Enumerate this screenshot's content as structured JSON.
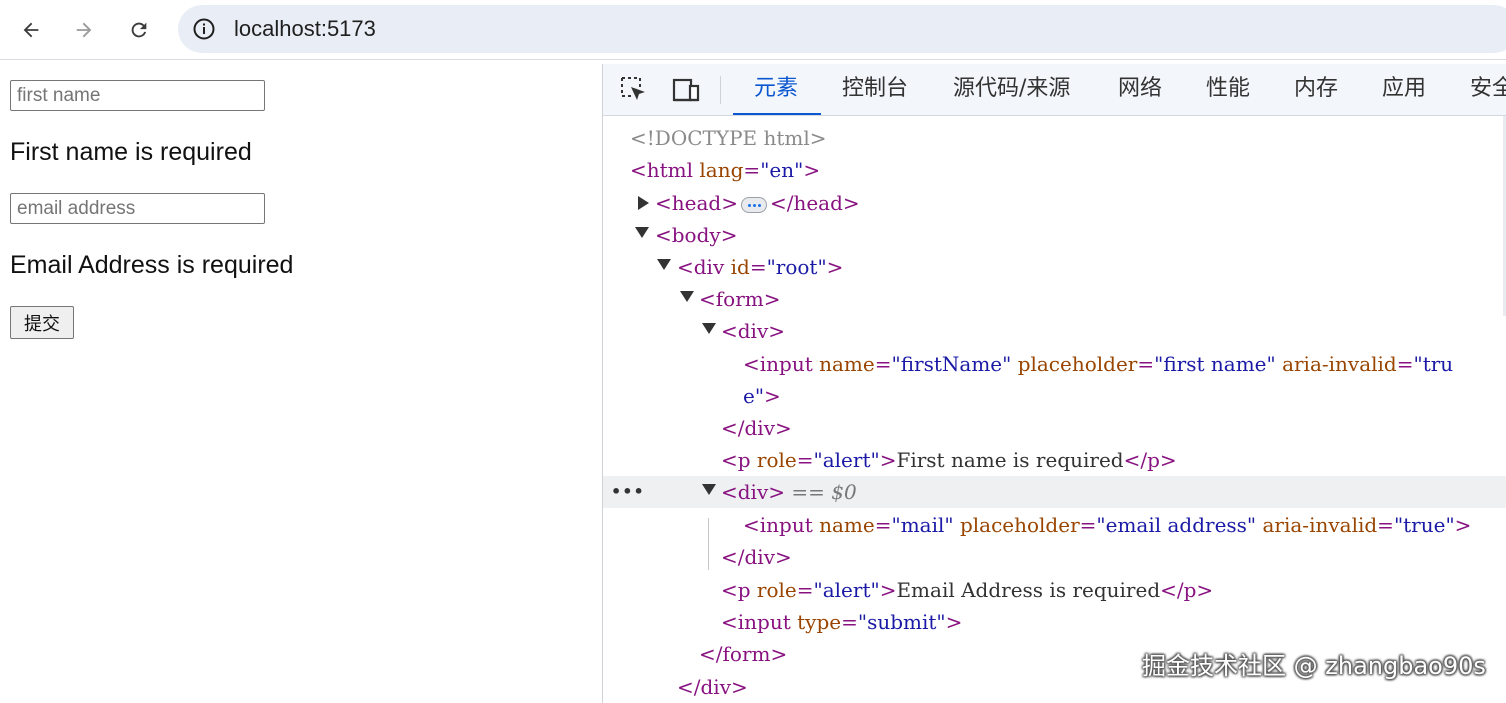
{
  "browser": {
    "url": "localhost:5173"
  },
  "form": {
    "first_name_placeholder": "first name",
    "first_name_value": "",
    "first_name_error": "First name is required",
    "email_placeholder": "email address",
    "email_value": "",
    "email_error": "Email Address is required",
    "submit_label": "提交"
  },
  "devtools": {
    "tabs": [
      "元素",
      "控制台",
      "源代码/来源",
      "网络",
      "性能",
      "内存",
      "应用",
      "安全"
    ],
    "active_tab": "元素",
    "tree": {
      "doctype": "<!DOCTYPE html>",
      "html_open": {
        "tag_open": "<html",
        "attr": "lang",
        "value": "\"en\"",
        "tag_close": ">"
      },
      "head": {
        "open": "<head>",
        "close": "</head>"
      },
      "body_open": "<body>",
      "root_div": {
        "tag_open": "<div",
        "attr": "id",
        "value": "\"root\"",
        "tag_close": ">"
      },
      "form_open": "<form>",
      "div1_open": "<div>",
      "input1": {
        "tag_open": "<input",
        "attr1": "name",
        "val1": "\"firstName\"",
        "attr2": "placeholder",
        "val2": "\"first name\"",
        "attr3": "aria-invalid",
        "val3_part1": "\"tru",
        "val3_part2": "e\"",
        "tag_close": ">"
      },
      "div1_close": "</div>",
      "p1": {
        "tag_open": "<p",
        "attr": "role",
        "value": "\"alert\"",
        "text": "First name is required",
        "tag_close": "</p>"
      },
      "div2_open": "<div>",
      "div2_marker": "== $0",
      "input2": {
        "tag_open": "<input",
        "attr1": "name",
        "val1": "\"mail\"",
        "attr2": "placeholder",
        "val2": "\"email address\"",
        "attr3": "aria-invalid",
        "val3": "\"true\"",
        "tag_close": ">"
      },
      "div2_close": "</div>",
      "p2": {
        "tag_open": "<p",
        "attr": "role",
        "value": "\"alert\"",
        "text": "Email Address is required",
        "tag_close": "</p>"
      },
      "submit_input": {
        "tag_open": "<input",
        "attr": "type",
        "value": "\"submit\"",
        "tag_close": ">"
      },
      "form_close": "</form>",
      "root_div_close": "</div>"
    }
  },
  "watermark": "掘金技术社区 @ zhangbao90s"
}
